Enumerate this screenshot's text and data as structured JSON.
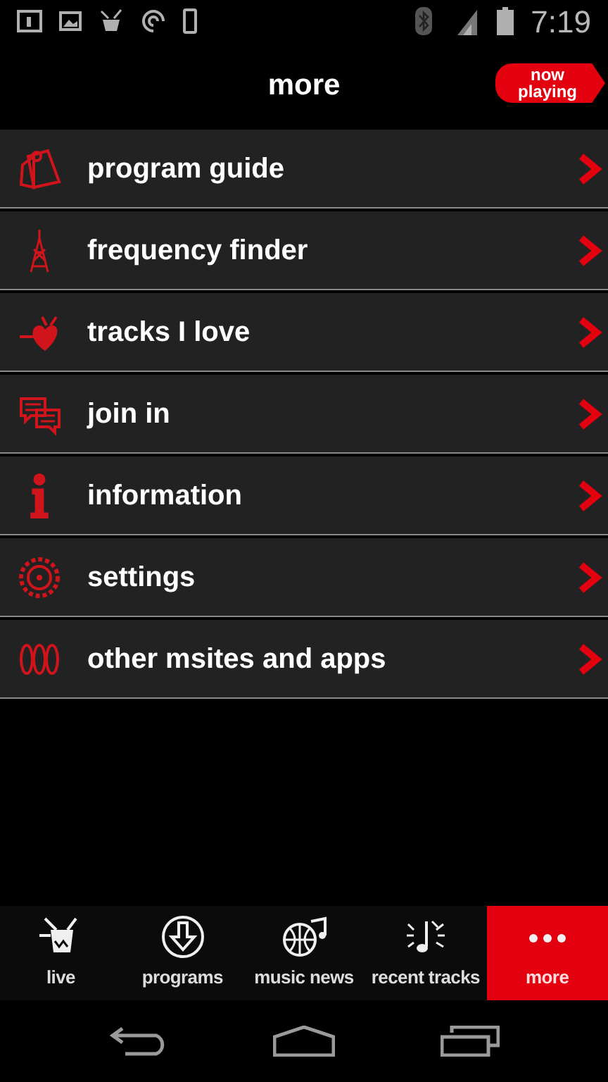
{
  "status_bar": {
    "time": "7:19"
  },
  "header": {
    "title": "more",
    "now_playing": "now playing"
  },
  "menu": [
    {
      "kind": "guide",
      "label": "program guide"
    },
    {
      "kind": "tower",
      "label": "frequency finder"
    },
    {
      "kind": "heart",
      "label": "tracks I love"
    },
    {
      "kind": "chat",
      "label": "join in"
    },
    {
      "kind": "info",
      "label": "information"
    },
    {
      "kind": "gear",
      "label": "settings"
    },
    {
      "kind": "apps",
      "label": "other msites and apps"
    }
  ],
  "tabs": [
    {
      "kind": "live",
      "label": "live",
      "selected": false
    },
    {
      "kind": "programs",
      "label": "programs",
      "selected": false
    },
    {
      "kind": "news",
      "label": "music news",
      "selected": false
    },
    {
      "kind": "recent",
      "label": "recent tracks",
      "selected": false
    },
    {
      "kind": "more",
      "label": "more",
      "selected": true
    }
  ]
}
